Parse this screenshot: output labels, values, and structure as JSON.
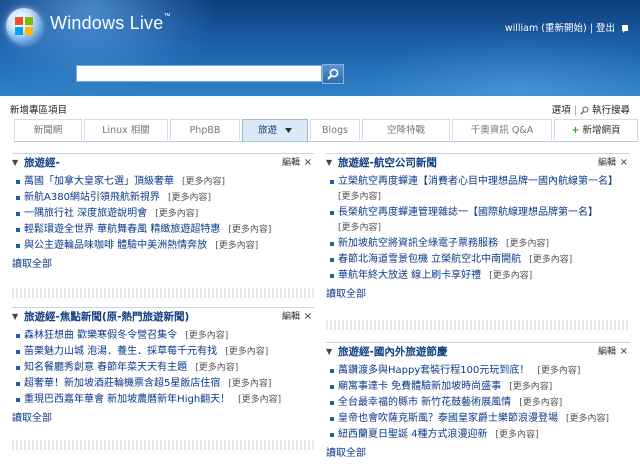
{
  "header": {
    "brand": "Windows Live",
    "trademark": "™",
    "user": "william (重新開始)",
    "separator": "|",
    "signout": "登出",
    "search_value": ""
  },
  "toolbar": {
    "new_page_items": "新增專區項目",
    "options": "選項",
    "run_search": "執行搜尋"
  },
  "tabs": [
    {
      "label": "新聞網"
    },
    {
      "label": "Linux 相關"
    },
    {
      "label": "PhpBB"
    },
    {
      "label": "旅遊"
    },
    {
      "label": "Blogs"
    },
    {
      "label": "空降特戰"
    },
    {
      "label": "千奧資訊 Q&A"
    },
    {
      "label": "新增網頁"
    }
  ],
  "common": {
    "edit": "編輯",
    "close": "×",
    "more": "[更多內容]",
    "read_all": "讀取全部"
  },
  "modules": {
    "m1": {
      "title": "旅遊經-",
      "items": [
        "萬國「加拿大皇家七選」頂級奢華",
        "新航A380網站引領飛航新視界",
        "一隅旅行社 深度旅遊說明會",
        "輕鬆環遊全世界 華航舞春風 精緻旅遊超特惠",
        "與公主遊輪品味咖啡 體驗中美洲熱情奔放"
      ]
    },
    "m2": {
      "title": "旅遊經-航空公司新聞",
      "items": [
        "立榮航空再度蟬連【消費者心目中理想品牌一國內航線第一名】",
        "長榮航空再度蟬連管理雜誌一【國際航線理想品牌第一名】",
        "新加坡航空將資訊全綠電子票務服務",
        "春節北海道雪景包機 立榮航空北中南開航",
        "華航年終大放送 線上刷卡享好禮"
      ]
    },
    "m3": {
      "title": "旅遊經-焦點新聞(原-熱門旅遊新聞)",
      "items": [
        "森林狂想曲 歡樂寒假冬令營召集令",
        "苗栗魅力山城 泡湯．養生．採草莓千元有找",
        "知名餐廳秀創意 春節年菜天天有主題",
        "超奢華！新加坡酒莊輪機票含超5星飯店住宿",
        "重現巴西嘉年華會 新加坡農曆新年High翻天！"
      ]
    },
    "m4": {
      "title": "旅遊經-國內外旅遊節慶",
      "items": [
        "萬鑽渡多與Happy套裝行程100元玩到底！",
        "廟寓事達卡 免費體驗新加坡時尚盛事",
        "全台最幸福的縣市 新竹花鼓藝術展風情",
        "皇帝也會吹薩克斯風？泰國皇家爵士樂節浪漫登場",
        "紐西蘭夏日聖誕 4種方式浪漫迎新"
      ]
    }
  }
}
